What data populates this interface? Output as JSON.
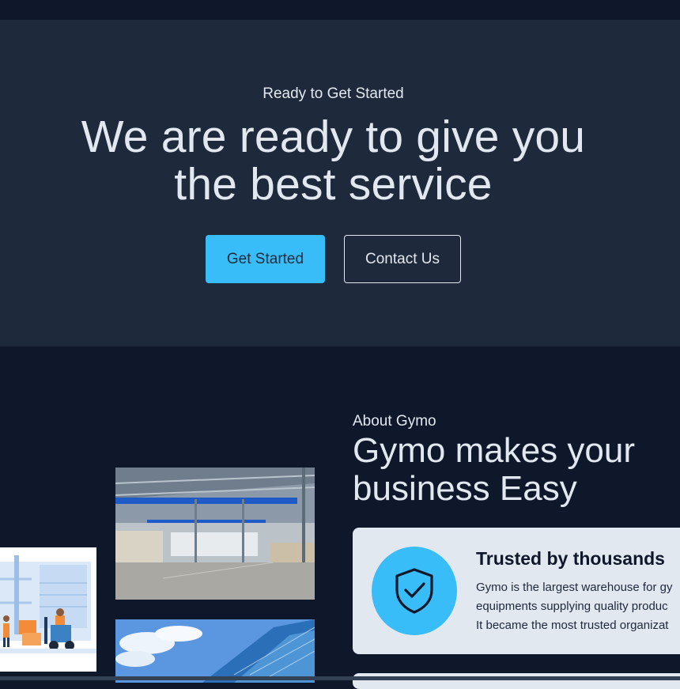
{
  "hero": {
    "eyebrow": "Ready to Get Started",
    "title_line1": "We are ready to give you",
    "title_line2": "the best service",
    "primary_button": "Get Started",
    "secondary_button": "Contact Us"
  },
  "about": {
    "eyebrow": "About Gymo",
    "title_line1": "Gymo makes your",
    "title_line2": "business Easy",
    "card": {
      "icon": "shield-check-icon",
      "title": "Trusted by thousands",
      "text_line1": "Gymo is the largest warehouse for gy",
      "text_line2": "equipments supplying quality produc",
      "text_line3": "It became the most trusted organizat"
    }
  },
  "colors": {
    "background": "#0f172a",
    "hero_background": "#1e293b",
    "accent": "#38bdf8",
    "card_background": "#e2e8f0",
    "text_light": "#e2e8f0",
    "text_dark": "#0f172a"
  }
}
